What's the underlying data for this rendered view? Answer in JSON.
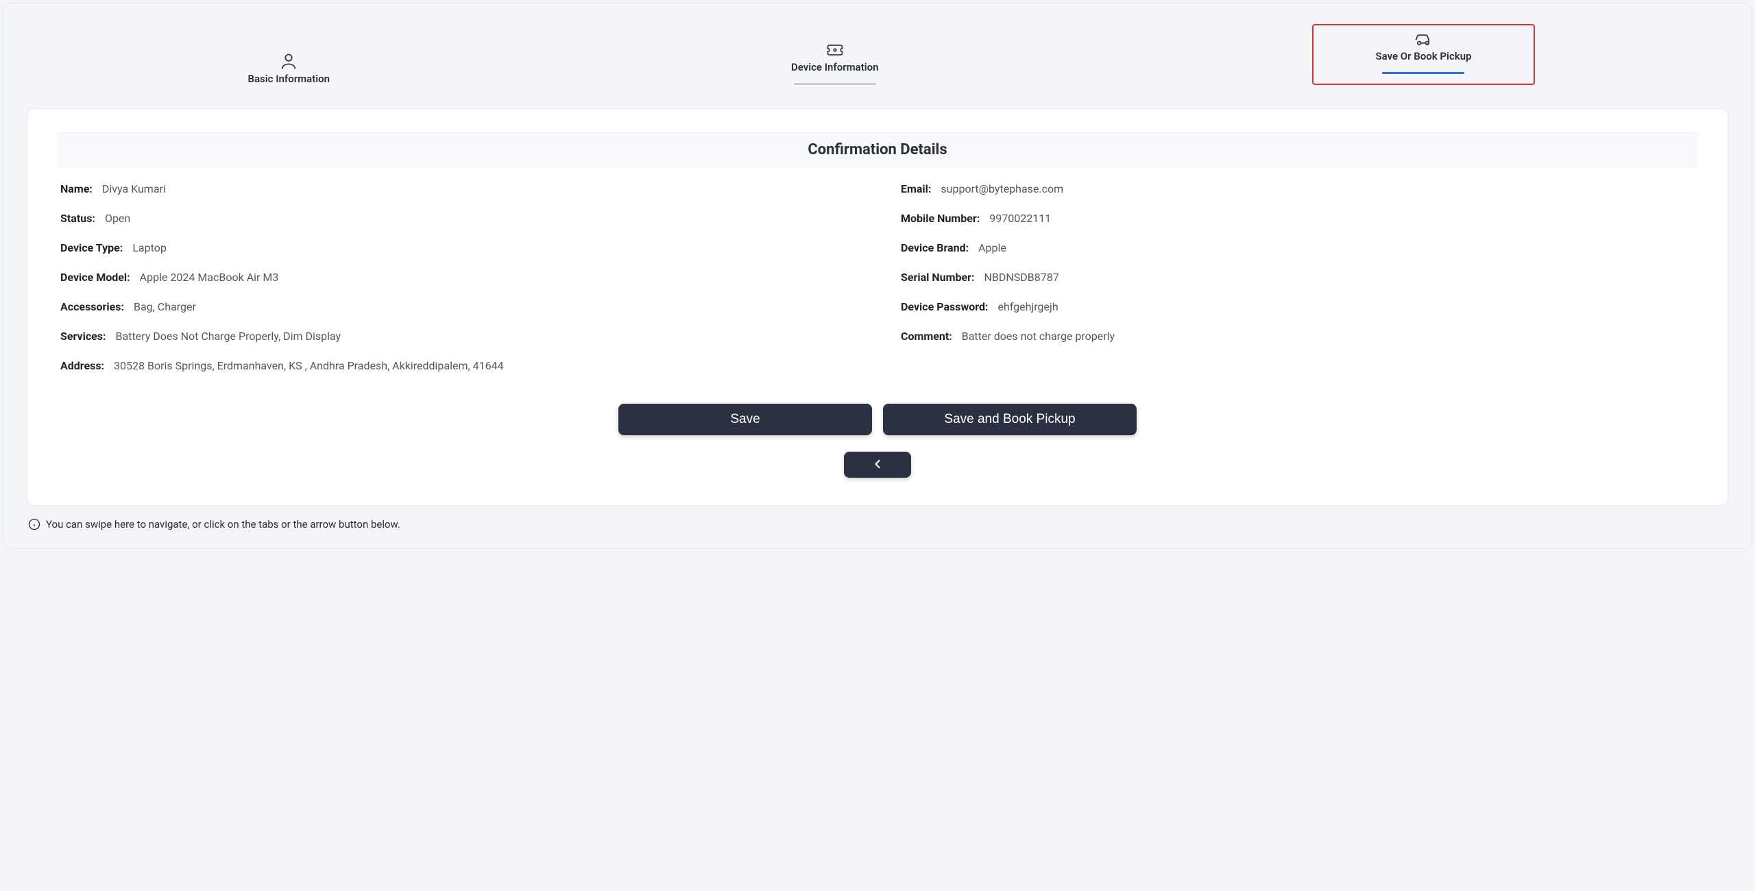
{
  "tabs": {
    "basic": {
      "label": "Basic Information"
    },
    "device": {
      "label": "Device Information"
    },
    "save": {
      "label": "Save Or Book Pickup"
    }
  },
  "section_title": "Confirmation Details",
  "fields": {
    "name": {
      "label": "Name:",
      "value": "Divya Kumari"
    },
    "email": {
      "label": "Email:",
      "value": "support@bytephase.com"
    },
    "status": {
      "label": "Status:",
      "value": "Open"
    },
    "mobile": {
      "label": "Mobile Number:",
      "value": "9970022111"
    },
    "device_type": {
      "label": "Device Type:",
      "value": "Laptop"
    },
    "device_brand": {
      "label": "Device Brand:",
      "value": "Apple"
    },
    "device_model": {
      "label": "Device Model:",
      "value": "Apple 2024 MacBook Air M3"
    },
    "serial_number": {
      "label": "Serial Number:",
      "value": "NBDNSDB8787"
    },
    "accessories": {
      "label": "Accessories:",
      "value": "Bag, Charger"
    },
    "device_password": {
      "label": "Device Password:",
      "value": "ehfgehjrgejh"
    },
    "services": {
      "label": "Services:",
      "value": "Battery Does Not Charge Properly, Dim Display"
    },
    "comment": {
      "label": "Comment:",
      "value": "Batter does not charge properly"
    },
    "address": {
      "label": "Address:",
      "value": "30528 Boris Springs, Erdmanhaven, KS , Andhra Pradesh, Akkireddipalem, 41644"
    }
  },
  "buttons": {
    "save": "Save",
    "save_book": "Save and Book Pickup"
  },
  "hint": "You can swipe here to navigate, or click on the tabs or the arrow button below."
}
